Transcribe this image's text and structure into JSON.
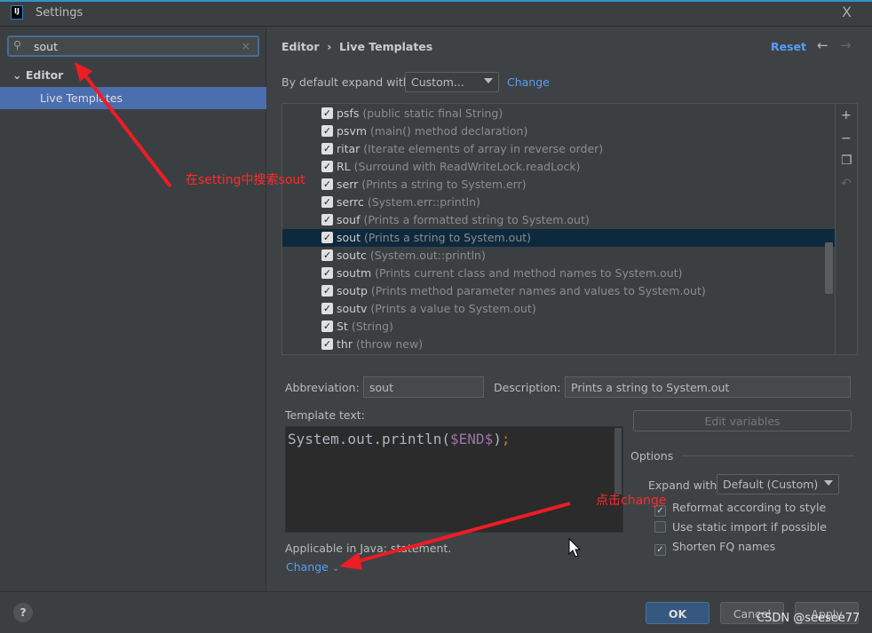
{
  "window": {
    "title": "Settings",
    "logo": "IJ",
    "close": "X"
  },
  "search": {
    "value": "sout",
    "icon": "search-icon"
  },
  "tree": {
    "editor": "Editor",
    "live_templates": "Live Templates"
  },
  "header": {
    "breadcrumb": "Editor  ›  Live Templates",
    "reset": "Reset"
  },
  "expand": {
    "label": "By default expand with",
    "value": "Custom...",
    "change": "Change"
  },
  "templates": [
    {
      "abbr": "psfs",
      "desc": "(public static final String)",
      "checked": true
    },
    {
      "abbr": "psvm",
      "desc": "(main() method declaration)",
      "checked": true
    },
    {
      "abbr": "ritar",
      "desc": "(Iterate elements of array in reverse order)",
      "checked": true
    },
    {
      "abbr": "RL",
      "desc": "(Surround with ReadWriteLock.readLock)",
      "checked": true
    },
    {
      "abbr": "serr",
      "desc": "(Prints a string to System.err)",
      "checked": true
    },
    {
      "abbr": "serrc",
      "desc": "(System.err::println)",
      "checked": true
    },
    {
      "abbr": "souf",
      "desc": "(Prints a formatted string to System.out)",
      "checked": true
    },
    {
      "abbr": "sout",
      "desc": "(Prints a string to System.out)",
      "checked": true,
      "selected": true
    },
    {
      "abbr": "soutc",
      "desc": "(System.out::println)",
      "checked": true
    },
    {
      "abbr": "soutm",
      "desc": "(Prints current class and method names to System.out)",
      "checked": true
    },
    {
      "abbr": "soutp",
      "desc": "(Prints method parameter names and values to System.out)",
      "checked": true
    },
    {
      "abbr": "soutv",
      "desc": "(Prints a value to System.out)",
      "checked": true
    },
    {
      "abbr": "St",
      "desc": "(String)",
      "checked": true
    },
    {
      "abbr": "thr",
      "desc": "(throw new)",
      "checked": true
    }
  ],
  "detail": {
    "abbr_label": "Abbreviation:",
    "abbr": "sout",
    "desc_label": "Description:",
    "desc": "Prints a string to System.out",
    "tpl_label": "Template text:",
    "tpl_pre": "System.out.println(",
    "tpl_var": "$END$",
    "tpl_post": ")",
    "tpl_semi": ";",
    "edit_vars": "Edit variables",
    "options": "Options",
    "expand_with": "Expand with",
    "expand_value": "Default (Custom)",
    "reformat": "Reformat according to style",
    "static_import": "Use static import if possible",
    "shorten": "Shorten FQ names",
    "applicable": "Applicable in Java: statement.",
    "change": "Change"
  },
  "footer": {
    "help": "?",
    "ok": "OK",
    "cancel": "Cancel",
    "apply": "Apply"
  },
  "annotations": {
    "search_note": "在setting中搜索sout",
    "change_note": "点击change",
    "color": "#ff2a2a"
  },
  "watermark": "CSDN @seesee77"
}
